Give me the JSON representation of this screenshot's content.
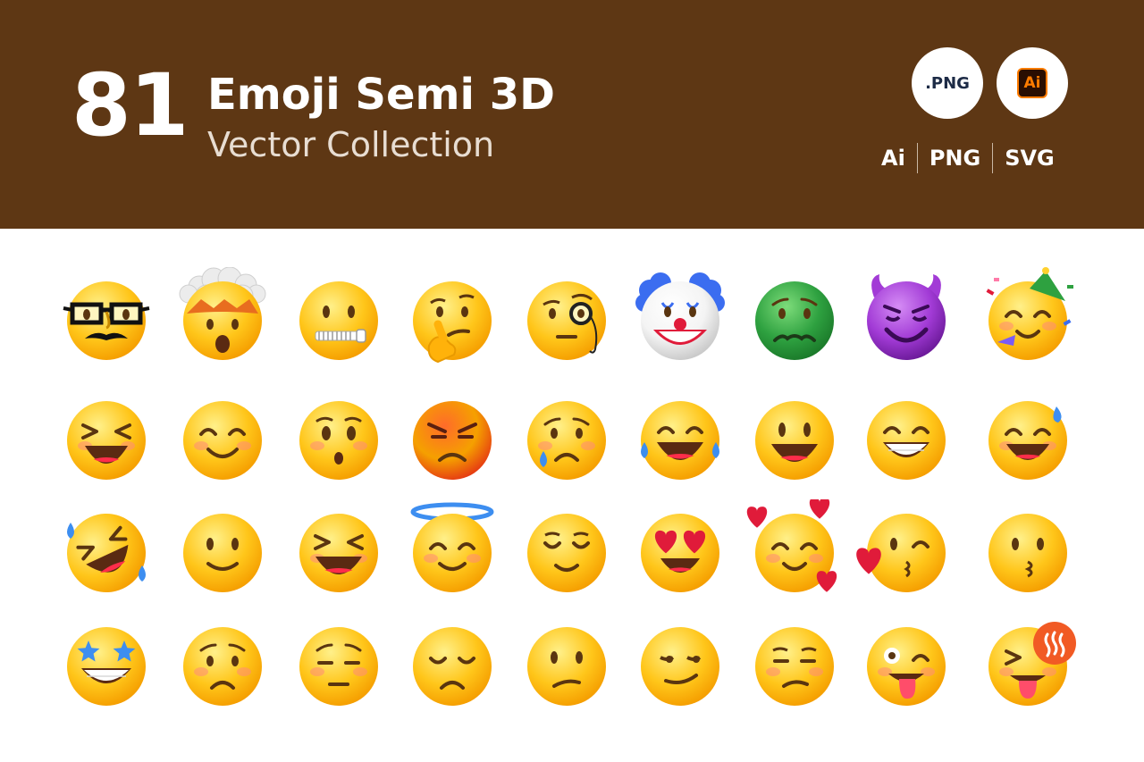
{
  "header": {
    "count": "81",
    "title": "Emoji Semi 3D",
    "subtitle": "Vector Collection",
    "badge_png": ".PNG",
    "badge_ai": "Ai",
    "formats": [
      "Ai",
      "PNG",
      "SVG"
    ]
  },
  "colors": {
    "banner": "#5e3714",
    "emoji_yellow": "#ffc61a",
    "emoji_green": "#2ea140",
    "emoji_purple": "#a23bd6"
  },
  "emoji_rows": [
    [
      "disguised-face-icon",
      "exploding-head-icon",
      "zipper-mouth-face-icon",
      "thinking-face-icon",
      "monocle-face-icon",
      "clown-face-icon",
      "nauseated-face-icon",
      "smiling-devil-icon",
      "partying-face-icon"
    ],
    [
      "squinting-laughing-face-icon",
      "smiling-face-icon",
      "hushed-face-icon",
      "angry-face-icon",
      "crying-face-icon",
      "tears-of-joy-face-icon",
      "grinning-face-icon",
      "beaming-face-icon",
      "grinning-sweat-face-icon"
    ],
    [
      "rolling-laughing-face-icon",
      "slightly-smiling-face-icon",
      "laughing-face-icon",
      "halo-face-icon",
      "relieved-face-icon",
      "heart-eyes-face-icon",
      "smiling-hearts-face-icon",
      "blowing-kiss-face-icon",
      "kissing-face-icon"
    ],
    [
      "star-struck-face-icon",
      "worried-face-icon",
      "pensive-face-icon",
      "disappointed-face-icon",
      "confused-face-icon",
      "smirking-face-icon",
      "unamused-face-icon",
      "zany-face-icon",
      "tongue-wink-face-icon"
    ]
  ]
}
